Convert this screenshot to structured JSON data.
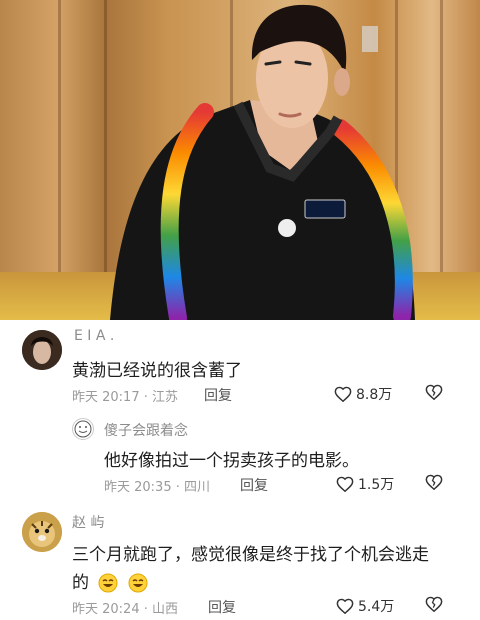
{
  "comments": [
    {
      "username": "E I A .",
      "text": "黄渤已经说的很含蓄了",
      "time": "昨天 20:17 · 江苏",
      "reply_label": "回复",
      "likes": "8.8万"
    },
    {
      "username": "傻子会跟着念",
      "text": "他好像拍过一个拐卖孩子的电影。",
      "time": "昨天 20:35 · 四川",
      "reply_label": "回复",
      "likes": "1.5万"
    },
    {
      "username": "赵 屿",
      "text_line1": "三个月就跑了，感觉很像是终于找了个机会逃走",
      "text_line2": "的",
      "time": "昨天 20:24 · 山西",
      "reply_label": "回复",
      "likes": "5.4万"
    }
  ],
  "colors": {
    "username": "#8c8c8c",
    "text": "#1e1e1e",
    "meta": "#9a9a9a"
  },
  "icons": [
    "heart-icon",
    "broken-heart-icon",
    "avatar",
    "laughing-emoji-icon"
  ]
}
